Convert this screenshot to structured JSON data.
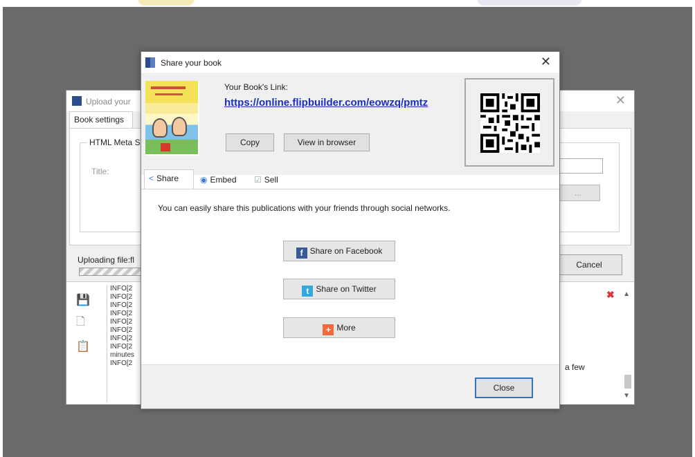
{
  "background_window": {
    "title": "Upload your",
    "tab": "Book settings",
    "group_label": "HTML Meta Se",
    "title_label": "Title:",
    "dots_button": "...",
    "uploading_label": "Uploading file:fl",
    "cancel_button": "Cancel",
    "log_lines": [
      "INFO[2",
      "INFO[2",
      "INFO[2",
      "INFO[2",
      "INFO[2",
      "INFO[2",
      "INFO[2",
      "INFO[2",
      "minutes",
      "INFO[2"
    ],
    "few_text": "a few"
  },
  "dialog": {
    "title": "Share your book",
    "link_label": "Your Book's Link:",
    "link_url": "https://online.flipbuilder.com/eowzq/pmtz",
    "copy_button": "Copy",
    "view_button": "View in browser",
    "tabs": {
      "share": "Share",
      "embed": "Embed",
      "sell": "Sell"
    },
    "description": "You can easily share this publications with your friends through social networks.",
    "share_facebook": "Share on Facebook",
    "share_twitter": "Share on Twitter",
    "share_more": "More",
    "close_button": "Close"
  },
  "colors": {
    "link": "#1a2fc0",
    "facebook": "#3b5998",
    "twitter": "#31a8e0",
    "more": "#f26b3a",
    "focus_border": "#2f73c9"
  }
}
